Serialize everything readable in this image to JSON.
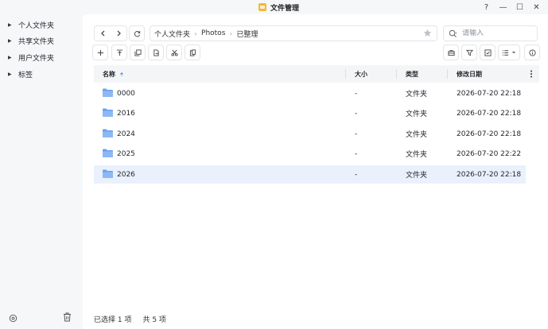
{
  "window": {
    "title": "文件管理",
    "controls": {
      "help": "?",
      "minimize": "—",
      "maximize": "☐",
      "close": "✕"
    }
  },
  "sidebar": {
    "items": [
      {
        "label": "个人文件夹"
      },
      {
        "label": "共享文件夹"
      },
      {
        "label": "用户文件夹"
      },
      {
        "label": "标签"
      }
    ]
  },
  "path": {
    "crumbs": [
      "个人文件夹",
      "Photos",
      "已整理"
    ]
  },
  "search": {
    "placeholder": "请输入",
    "value": ""
  },
  "table": {
    "columns": {
      "name": "名称",
      "size": "大小",
      "type": "类型",
      "modified": "修改日期"
    },
    "sort": {
      "column": "name",
      "direction": "ascending"
    },
    "rows": [
      {
        "name": "0000",
        "size": "-",
        "type": "文件夹",
        "modified": "2026-07-20 22:18",
        "selected": false
      },
      {
        "name": "2016",
        "size": "-",
        "type": "文件夹",
        "modified": "2026-07-20 22:18",
        "selected": false
      },
      {
        "name": "2024",
        "size": "-",
        "type": "文件夹",
        "modified": "2026-07-20 22:18",
        "selected": false
      },
      {
        "name": "2025",
        "size": "-",
        "type": "文件夹",
        "modified": "2026-07-20 22:22",
        "selected": false
      },
      {
        "name": "2026",
        "size": "-",
        "type": "文件夹",
        "modified": "2026-07-20 22:18",
        "selected": true
      }
    ]
  },
  "status": {
    "selected": "已选择 1 项",
    "total": "共 5 项"
  },
  "colors": {
    "accent": "#3b7cf0",
    "folder": "#6aa2f0",
    "selected_row": "#eaf1fd",
    "app_icon": "#f5b73b"
  }
}
